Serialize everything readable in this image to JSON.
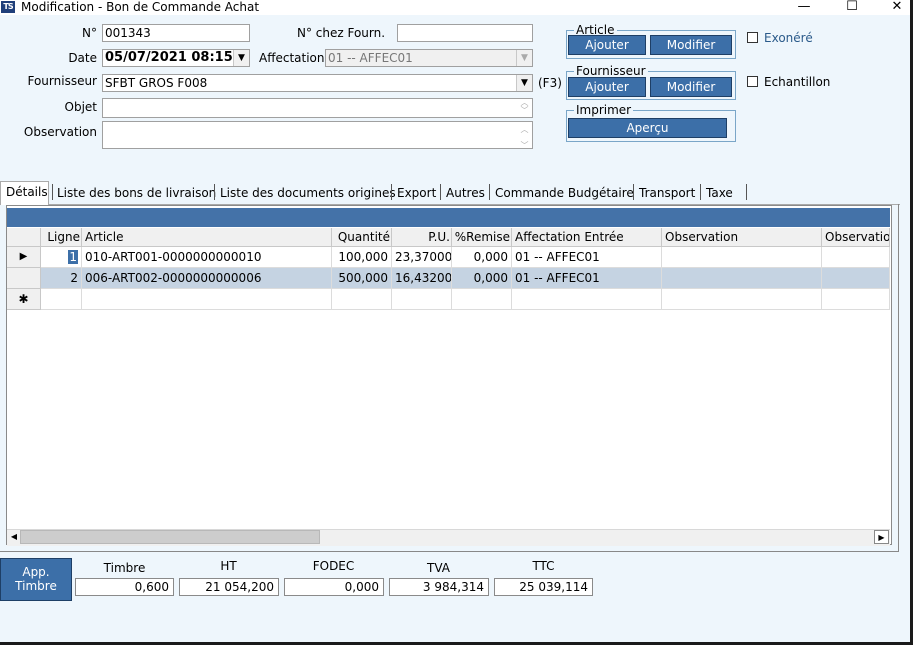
{
  "window": {
    "title": "Modification - Bon de Commande Achat",
    "icon_text": "TS",
    "minimize": "—",
    "maximize": "☐",
    "close": "✕"
  },
  "form": {
    "no_label": "N°",
    "no_value": "001343",
    "no_fourn_label": "N° chez Fourn.",
    "no_fourn_value": "",
    "date_label": "Date",
    "date_value": "05/07/2021 08:15:",
    "affectation_label": "Affectation",
    "affectation_value": "01 -- AFFEC01",
    "fournisseur_label": "Fournisseur",
    "fournisseur_value": "SFBT GROS F008",
    "f3_hint": "(F3)",
    "objet_label": "Objet",
    "objet_value": "",
    "observation_label": "Observation",
    "observation_value": ""
  },
  "groups": {
    "article": {
      "label": "Article",
      "add": "Ajouter",
      "edit": "Modifier"
    },
    "fournisseur": {
      "label": "Fournisseur",
      "add": "Ajouter",
      "edit": "Modifier"
    },
    "imprimer": {
      "label": "Imprimer",
      "preview": "Aperçu"
    }
  },
  "checkboxes": {
    "exonere": "Exonéré",
    "echantillon": "Echantillon"
  },
  "tabs": [
    "Détails",
    "Liste des bons de livraison",
    "Liste des documents origines",
    "Export",
    "Autres",
    "Commande Budgétaire",
    "Transport",
    "Taxe"
  ],
  "grid": {
    "columns": [
      "Ligne",
      "Article",
      "Quantité",
      "P.U.",
      "%Remise",
      "Affectation Entrée",
      "Observation",
      "Observation"
    ],
    "rows": [
      {
        "marker": "▶",
        "ligne": "1",
        "article": "010-ART001-0000000000010",
        "quantite": "100,000",
        "pu": "23,37000",
        "remise": "0,000",
        "affectation": "01 -- AFFEC01",
        "obs1": "",
        "obs2": ""
      },
      {
        "marker": "",
        "ligne": "2",
        "article": "006-ART002-0000000000006",
        "quantite": "500,000",
        "pu": "16,43200",
        "remise": "0,000",
        "affectation": "01 -- AFFEC01",
        "obs1": "",
        "obs2": ""
      }
    ],
    "new_row_marker": "✱",
    "scroll_left": "◀",
    "scroll_right": "▶"
  },
  "totals": {
    "app_timbre_label": "App. Timbre",
    "timbre_label": "Timbre",
    "timbre_value": "0,600",
    "ht_label": "HT",
    "ht_value": "21 054,200",
    "fodec_label": "FODEC",
    "fodec_value": "0,000",
    "tva_label": "TVA",
    "tva_value": "3 984,314",
    "ttc_label": "TTC",
    "ttc_value": "25 039,114"
  },
  "colors": {
    "accent": "#3c6fa8",
    "grid_header": "#4472a8",
    "selected_row": "#c5d3e2",
    "background": "#eef6fc"
  }
}
